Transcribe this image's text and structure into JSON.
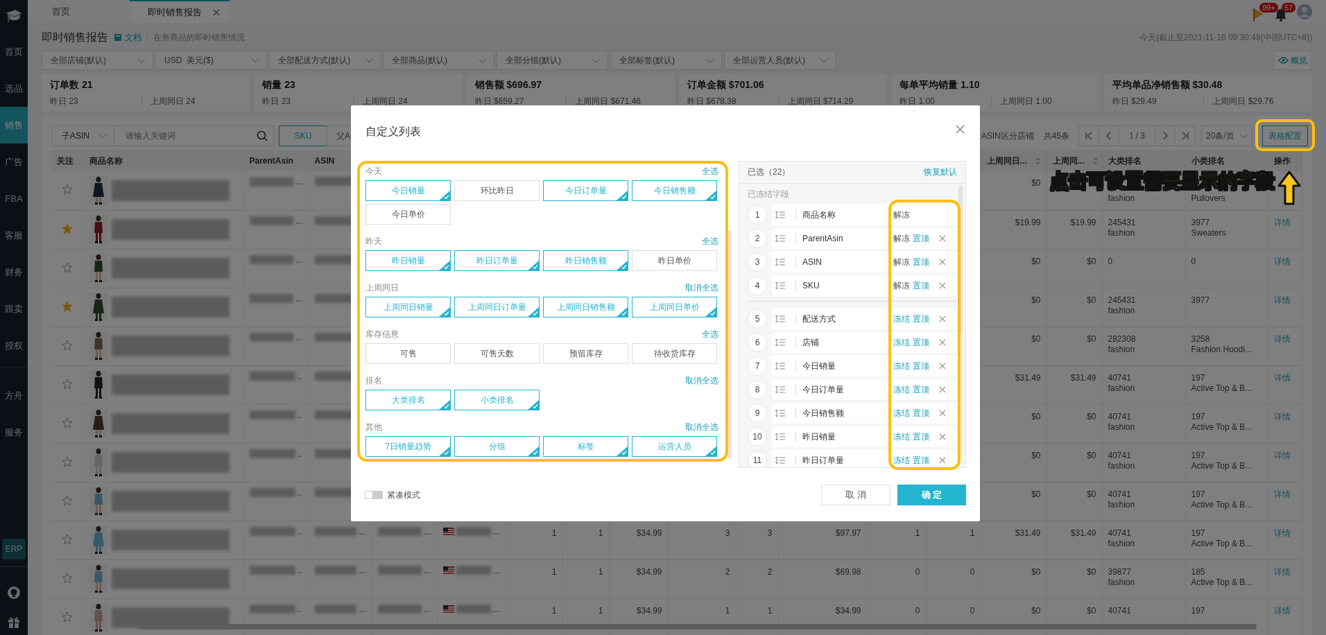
{
  "topbar": {
    "tabs": [
      {
        "label": "首页",
        "selected": false,
        "closable": false
      },
      {
        "label": "即时销售报告",
        "selected": true,
        "closable": true
      }
    ],
    "flag_badge": "99+",
    "bell_badge": "57"
  },
  "sidebar": {
    "items": [
      {
        "label": "首页",
        "selected": false
      },
      {
        "label": "选品",
        "selected": false
      },
      {
        "label": "销售",
        "selected": true
      },
      {
        "label": "广告",
        "selected": false
      },
      {
        "label": "FBA",
        "selected": false
      },
      {
        "label": "客服",
        "selected": false
      },
      {
        "label": "财务",
        "selected": false
      },
      {
        "label": "跟卖",
        "selected": false
      },
      {
        "label": "授权",
        "selected": false
      }
    ],
    "lower_items": [
      {
        "label": "方舟",
        "selected": false
      },
      {
        "label": "服务",
        "selected": false
      }
    ],
    "erp": "ERP"
  },
  "header": {
    "title": "即时销售报告",
    "doc_link": "文档",
    "subtitle": "在售商品的即时销售情况",
    "timestamp": "今天(截止至2021-11-18 09:30:49(中国UTC+8))"
  },
  "filters": [
    "全部店铺(默认)",
    "USD  美元($)",
    "全部配送方式(默认)",
    "全部商品(默认)",
    "全部分组(默认)",
    "全部标签(默认)",
    "全部运营人员(默认)"
  ],
  "overview_button": "概览",
  "stats": [
    {
      "title": "订单数 21",
      "yesterday": "昨日 23",
      "last_week": "上周同日 24"
    },
    {
      "title": "销量 23",
      "yesterday": "昨日 23",
      "last_week": "上周同日 24"
    },
    {
      "title": "销售额 $696.97",
      "yesterday": "昨日 $659.27",
      "last_week": "上周同日 $671.46"
    },
    {
      "title": "订单金额 $701.06",
      "yesterday": "昨日 $678.38",
      "last_week": "上周同日 $714.29"
    },
    {
      "title": "每单平均销量 1.10",
      "yesterday": "昨日 1.00",
      "last_week": "上周同日 1.00"
    },
    {
      "title": "平均单品净销售额 $30.48",
      "yesterday": "昨日 $29.49",
      "last_week": "上周同日 $29.76"
    }
  ],
  "toolbar": {
    "search_type": "子ASIN",
    "search_placeholder": "请输入关键词",
    "modes": [
      {
        "label": "SKU",
        "selected": true
      },
      {
        "label": "父A",
        "selected": false
      }
    ],
    "store_split": "ASIN区分店铺",
    "total": "共45条",
    "page": "1",
    "page_total": "/ 3",
    "page_size": "20条/页",
    "config_button": "表格配置"
  },
  "table": {
    "left_columns": [
      {
        "label": "关注",
        "sortable": false
      },
      {
        "label": "商品名称",
        "sortable": false
      },
      {
        "label": "ParentAsin",
        "sortable": false
      },
      {
        "label": "ASIN",
        "sortable": false
      }
    ],
    "right_columns": [
      {
        "label": "上周同日...",
        "sortable": true
      },
      {
        "label": "上周同...",
        "sortable": true
      },
      {
        "label": "大类排名",
        "sortable": false
      },
      {
        "label": "小类排名",
        "sortable": false
      },
      {
        "label": "操作",
        "sortable": false
      }
    ],
    "rows": [
      {
        "starred": false,
        "thumbnail": {
          "kind": "picture"
        },
        "parent_asin": "...",
        "last_week_1": "$0",
        "big_rank": {
          "category": "fashion"
        },
        "small_rank": {
          "category": "Pullovers"
        }
      },
      {
        "starred": true,
        "thumbnail": {
          "kind": "picture"
        },
        "parent_asin": "...",
        "last_week_1": "$19.99",
        "last_week_2": "$19.99",
        "big_rank": {
          "rank": "245431",
          "category": "fashion"
        },
        "small_rank": {
          "rank": "3977",
          "category": "Sweaters"
        },
        "action": "详情"
      },
      {
        "starred": false,
        "thumbnail": {
          "kind": "picture"
        },
        "parent_asin": "...",
        "last_week_1": "$0",
        "last_week_2": "$0",
        "big_rank": {
          "rank": "0"
        },
        "small_rank": {
          "rank": "0"
        },
        "action": "详情"
      },
      {
        "starred": true,
        "thumbnail": {
          "kind": "picture"
        },
        "parent_asin": "...",
        "last_week_1": "$0",
        "last_week_2": "$0",
        "big_rank": {
          "rank": "245431",
          "category": "fashion"
        },
        "small_rank": {
          "rank": "3977"
        },
        "action": "详情"
      },
      {
        "starred": false,
        "thumbnail": {
          "kind": "picture"
        },
        "parent_asin": "...",
        "last_week_1": "$0",
        "last_week_2": "$0",
        "big_rank": {
          "rank": "282308",
          "category": "fashion"
        },
        "small_rank": {
          "rank": "3258",
          "category": "Fashion Hoodi..."
        },
        "action": "详情"
      },
      {
        "starred": false,
        "thumbnail": {
          "kind": "picture"
        },
        "parent_asin": "..",
        "last_week_1": "$31.49",
        "last_week_2": "$31.49",
        "big_rank": {
          "rank": "40741",
          "category": "fashion"
        },
        "small_rank": {
          "rank": "197",
          "category": "Active Top & B..."
        },
        "action": "详情"
      },
      {
        "starred": false,
        "thumbnail": {
          "kind": "picture"
        },
        "parent_asin": "..",
        "last_week_1": "$0",
        "last_week_2": "$0",
        "big_rank": {
          "rank": "40741",
          "category": "fashion"
        },
        "small_rank": {
          "rank": "197",
          "category": "Active Top & B..."
        },
        "action": "详情"
      },
      {
        "starred": false,
        "thumbnail": {
          "kind": "picture"
        },
        "parent_asin": "..",
        "last_week_1": "$0",
        "last_week_2": "$0",
        "big_rank": {
          "rank": "40741",
          "category": "fashion"
        },
        "small_rank": {
          "rank": "197",
          "category": "Active Top & B..."
        },
        "action": "详情"
      },
      {
        "starred": false,
        "thumbnail": {
          "kind": "picture"
        },
        "parent_asin": "..",
        "last_week_1": "$0",
        "last_week_2": "$0",
        "big_rank": {
          "rank": "40741",
          "category": "fashion"
        },
        "small_rank": {
          "rank": "197",
          "category": "Active Top & B..."
        },
        "action": "详情"
      },
      {
        "starred": false,
        "thumbnail": {
          "kind": "picture"
        },
        "parent_asin": "..",
        "asin": "...",
        "sku": "...",
        "store": "...",
        "values": [
          "1",
          "1",
          "$34.99",
          "3",
          "3",
          "$97.97",
          "1",
          "1"
        ],
        "last_week_1": "$31.49",
        "last_week_2": "$31.49",
        "big_rank": {
          "rank": "40741",
          "category": "fashion"
        },
        "small_rank": {
          "rank": "197",
          "category": "Active Top & B..."
        },
        "action": "详情"
      },
      {
        "starred": false,
        "thumbnail": {
          "kind": "picture"
        },
        "parent_asin": "..",
        "asin": "...",
        "sku": "...",
        "store": "...",
        "values": [
          "1",
          "1",
          "$34.99",
          "2",
          "2",
          "$69.98",
          "0",
          "0"
        ],
        "last_week_1": "$0",
        "last_week_2": "$0",
        "big_rank": {
          "rank": "39877",
          "category": "fashion"
        },
        "small_rank": {
          "rank": "185",
          "category": "Active Top & B..."
        },
        "action": "详情"
      },
      {
        "starred": false,
        "thumbnail": {
          "kind": "picture"
        },
        "parent_asin": "..",
        "asin": "...",
        "sku": "...",
        "store": "...",
        "values": [
          "1",
          "1",
          "$34.99",
          "1",
          "1",
          "$34.99",
          "0",
          "0"
        ],
        "last_week_1": "$0",
        "last_week_2": "$0",
        "big_rank": {
          "rank": "40741"
        },
        "small_rank": {
          "rank": "197"
        },
        "action": "详情"
      }
    ]
  },
  "modal": {
    "title": "自定义列表",
    "groups": [
      {
        "name": "今天",
        "action": "全选",
        "options": [
          {
            "label": "今日销量",
            "selected": true
          },
          {
            "label": "环比昨日",
            "selected": false
          },
          {
            "label": "今日订单量",
            "selected": true
          },
          {
            "label": "今日销售额",
            "selected": true
          },
          {
            "label": "今日单价",
            "selected": false
          }
        ]
      },
      {
        "name": "昨天",
        "action": "全选",
        "options": [
          {
            "label": "昨日销量",
            "selected": true
          },
          {
            "label": "昨日订单量",
            "selected": true
          },
          {
            "label": "昨日销售额",
            "selected": true
          },
          {
            "label": "昨日单价",
            "selected": false
          }
        ]
      },
      {
        "name": "上周同日",
        "action": "取消全选",
        "options": [
          {
            "label": "上周同日销量",
            "selected": true
          },
          {
            "label": "上周同日订单量",
            "selected": true
          },
          {
            "label": "上周同日销售额",
            "selected": true
          },
          {
            "label": "上周同日单价",
            "selected": true
          }
        ]
      },
      {
        "name": "库存信息",
        "action": "全选",
        "options": [
          {
            "label": "可售",
            "selected": false
          },
          {
            "label": "可售天数",
            "selected": false
          },
          {
            "label": "预留库存",
            "selected": false
          },
          {
            "label": "待收货库存",
            "selected": false
          }
        ]
      },
      {
        "name": "排名",
        "action": "取消全选",
        "options": [
          {
            "label": "大类排名",
            "selected": true
          },
          {
            "label": "小类排名",
            "selected": true
          }
        ]
      },
      {
        "name": "其他",
        "action": "取消全选",
        "options": [
          {
            "label": "7日销量趋势",
            "selected": true
          },
          {
            "label": "分组",
            "selected": true
          },
          {
            "label": "标签",
            "selected": true
          },
          {
            "label": "运营人员",
            "selected": true
          }
        ]
      }
    ],
    "compact_mode": {
      "label": "紧凑模式",
      "on": false
    },
    "selected_panel": {
      "title": "已选（22）",
      "reset": "恢复默认",
      "frozen_label": "已冻结字段",
      "frozen": [
        {
          "number": "1",
          "label": "商品名称",
          "freeze_action": "解冻",
          "removable": false
        },
        {
          "number": "2",
          "label": "ParentAsin",
          "freeze_action": "解冻",
          "pin_action": "置顶",
          "removable": true
        },
        {
          "number": "3",
          "label": "ASIN",
          "freeze_action": "解冻",
          "pin_action": "置顶",
          "removable": true
        },
        {
          "number": "4",
          "label": "SKU",
          "freeze_action": "解冻",
          "pin_action": "置顶",
          "removable": true
        }
      ],
      "fields": [
        {
          "number": "5",
          "label": "配送方式",
          "freeze_action": "冻结",
          "pin_action": "置顶",
          "removable": true
        },
        {
          "number": "6",
          "label": "店铺",
          "freeze_action": "冻结",
          "pin_action": "置顶",
          "removable": true
        },
        {
          "number": "7",
          "label": "今日销量",
          "freeze_action": "冻结",
          "pin_action": "置顶",
          "removable": true
        },
        {
          "number": "8",
          "label": "今日订单量",
          "freeze_action": "冻结",
          "pin_action": "置顶",
          "removable": true
        },
        {
          "number": "9",
          "label": "今日销售额",
          "freeze_action": "冻结",
          "pin_action": "置顶",
          "removable": true
        },
        {
          "number": "10",
          "label": "昨日销量",
          "freeze_action": "冻结",
          "pin_action": "置顶",
          "removable": true
        },
        {
          "number": "11",
          "label": "昨日订单量",
          "freeze_action": "冻结",
          "pin_action": "置顶",
          "removable": true
        }
      ]
    },
    "cancel_button": "取 消",
    "ok_button": "确 定"
  },
  "annotation": {
    "callout": "点击可设置需要显示的字段"
  }
}
